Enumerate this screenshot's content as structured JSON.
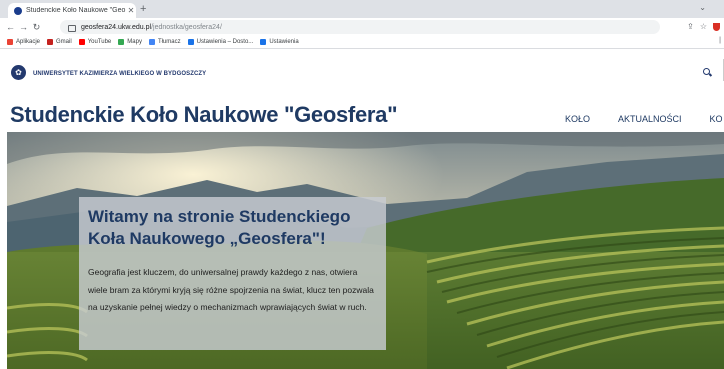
{
  "browser": {
    "tab_title": "Studenckie Koło Naukowe \"Geo...",
    "url_host": "geosfera24.ukw.edu.pl",
    "url_path": "/jednostka/geosfera24/",
    "bookmarks": [
      {
        "label": "Aplikacje",
        "color": "#ea4335"
      },
      {
        "label": "Gmail",
        "color": "#c5221f"
      },
      {
        "label": "YouTube",
        "color": "#ff0000"
      },
      {
        "label": "Mapy",
        "color": "#34a853"
      },
      {
        "label": "Tłumacz",
        "color": "#4285f4"
      },
      {
        "label": "Ustawienia – Dosto...",
        "color": "#1a73e8"
      },
      {
        "label": "Ustawienia",
        "color": "#1a73e8"
      }
    ]
  },
  "site": {
    "university": "UNIWERSYTET KAZIMIERZA WIELKIEGO W BYDGOSZCZY",
    "title": "Studenckie Koło Naukowe \"Geosfera\"",
    "menu": [
      "KOŁO",
      "AKTUALNOŚCI",
      "KO"
    ]
  },
  "hero": {
    "heading": "Witamy na stronie Studenckiego Koła Naukowego „Geosfera\"!",
    "body": "Geografia jest kluczem, do uniwersalnej prawdy każdego z nas, otwiera wiele bram za którymi kryją się różne spojrzenia na świat, klucz ten pozwala na uzyskanie pełnej wiedzy o mechanizmach wprawiających świat w ruch."
  },
  "colors": {
    "brand_navy": "#1f3a63",
    "tab_strip": "#dee1e6"
  },
  "icons": [
    "globe-icon",
    "close-icon",
    "plus-icon",
    "back-icon",
    "forward-icon",
    "reload-icon",
    "lock-icon",
    "share-icon",
    "star-icon",
    "shield-icon",
    "search-icon"
  ]
}
